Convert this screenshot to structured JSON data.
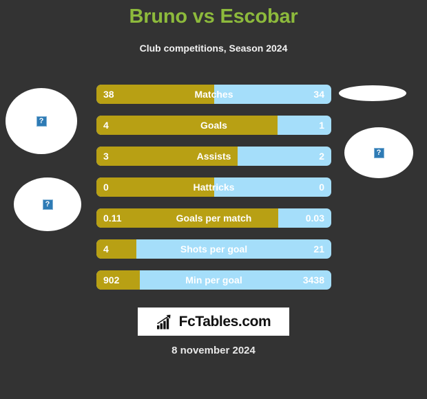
{
  "header": {
    "title": "Bruno vs Escobar",
    "subtitle": "Club competitions, Season 2024",
    "title_color": "#8dba3c"
  },
  "colors": {
    "background": "#333333",
    "home_bar": "#b8a014",
    "away_bar": "#a5defa",
    "value_text": "#ffffff",
    "placeholder_icon": "#2e7bb5"
  },
  "placeholders": {
    "home_1": "broken-image-icon",
    "home_2": "broken-image-icon",
    "away_1": "broken-image-icon",
    "away_2": "broken-image-icon",
    "glyph": "?"
  },
  "chart_data": {
    "type": "bar",
    "title": "Bruno vs Escobar",
    "subtitle": "Club competitions, Season 2024",
    "categories": [
      "Matches",
      "Goals",
      "Assists",
      "Hattricks",
      "Goals per match",
      "Shots per goal",
      "Min per goal"
    ],
    "series": [
      {
        "name": "Bruno",
        "values": [
          "38",
          "4",
          "3",
          "0",
          "0.11",
          "4",
          "902"
        ],
        "color": "#b8a014"
      },
      {
        "name": "Escobar",
        "values": [
          "34",
          "1",
          "2",
          "0",
          "0.03",
          "21",
          "3438"
        ],
        "color": "#a5defa"
      }
    ],
    "home_fill_percent": [
      50.0,
      77.0,
      60.0,
      50.0,
      77.5,
      17.0,
      18.5
    ],
    "legend": "none",
    "grid": false,
    "xlabel": "",
    "ylabel": ""
  },
  "rows": [
    {
      "label": "Matches",
      "home": "38",
      "away": "34",
      "home_pct": 50.0
    },
    {
      "label": "Goals",
      "home": "4",
      "away": "1",
      "home_pct": 77.0
    },
    {
      "label": "Assists",
      "home": "3",
      "away": "2",
      "home_pct": 60.0
    },
    {
      "label": "Hattricks",
      "home": "0",
      "away": "0",
      "home_pct": 50.0
    },
    {
      "label": "Goals per match",
      "home": "0.11",
      "away": "0.03",
      "home_pct": 77.5
    },
    {
      "label": "Shots per goal",
      "home": "4",
      "away": "21",
      "home_pct": 17.0
    },
    {
      "label": "Min per goal",
      "home": "902",
      "away": "3438",
      "home_pct": 18.5
    }
  ],
  "footer": {
    "logo_text": "FcTables.com",
    "logo_icon": "bar-chart-trend-icon",
    "date": "8 november 2024"
  }
}
